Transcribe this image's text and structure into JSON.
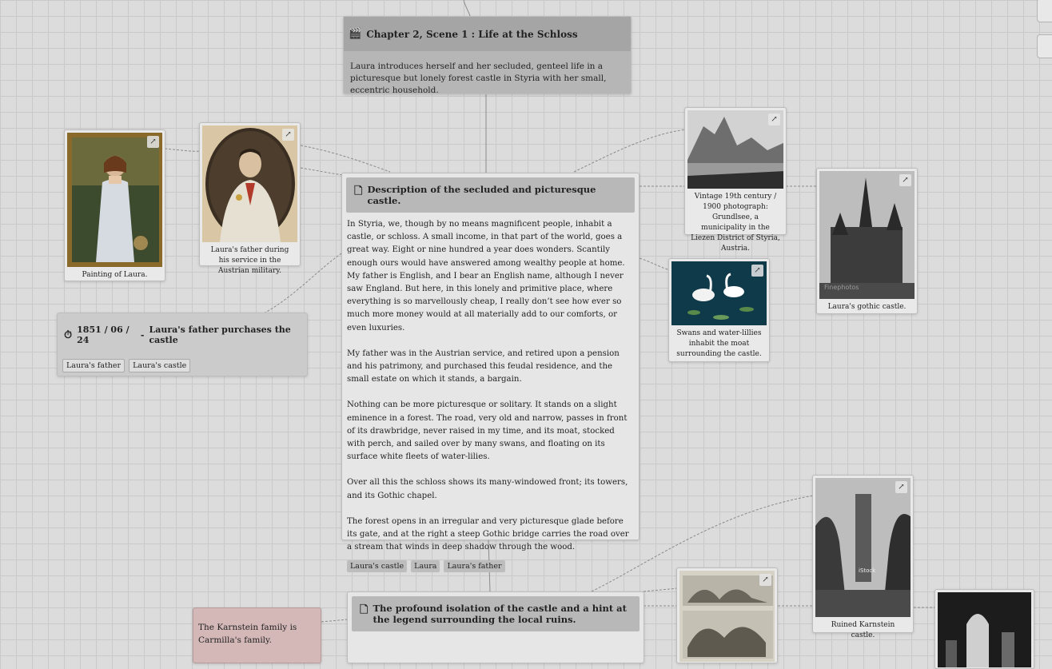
{
  "scene_card": {
    "icon": "clapperboard-icon",
    "title": "Chapter 2, Scene 1 : Life at the Schloss",
    "description": "Laura introduces herself and her secluded, genteel life in a picturesque but lonely forest castle in Styria with her small, eccentric household."
  },
  "description_card": {
    "icon": "document-icon",
    "title": "Description of the secluded and picturesque castle.",
    "paragraphs": [
      "In Styria, we, though by no means magnificent people, inhabit a castle, or schloss. A small income, in that part of the world, goes a great way. Eight or nine hundred a year does wonders. Scantily enough ours would have answered among wealthy people at home. My father is English, and I bear an English name, although I never saw England. But here, in this lonely and primitive place, where everything is so marvellously cheap, I really don’t see how ever so much more money would at all materially add to our comforts, or even luxuries.",
      "My father was in the Austrian service, and retired upon a pension and his patrimony, and purchased this feudal residence, and the small estate on which it stands, a bargain.",
      "Nothing can be more picturesque or solitary. It stands on a slight eminence in a forest. The road, very old and narrow, passes in front of its drawbridge, never raised in my time, and its moat, stocked with perch, and sailed over by many swans, and floating on its surface white fleets of water-lilies.",
      "Over all this the schloss shows its many-windowed front; its towers, and its Gothic chapel.",
      "The forest opens in an irregular and very picturesque glade before its gate, and at the right a steep Gothic bridge carries the road over a stream that winds in deep shadow through the wood."
    ],
    "tags": [
      "Laura's castle",
      "Laura",
      "Laura's father"
    ]
  },
  "event_card": {
    "icon": "stopwatch-icon",
    "date": "1851 / 06 / 24",
    "separator": "-",
    "title": "Laura's father purchases the castle",
    "tags": [
      "Laura's father",
      "Laura's castle"
    ]
  },
  "isolation_card": {
    "icon": "document-icon",
    "title": "The profound isolation of the castle and a hint at the legend surrounding the local ruins."
  },
  "karnstein_note": {
    "text": "The Karnstein family is Carmilla's family."
  },
  "images": {
    "laura_painting": {
      "caption": "Painting of Laura."
    },
    "father_portrait": {
      "caption": "Laura's father during his service in the Austrian military."
    },
    "grundlsee": {
      "caption": "Vintage 19th century / 1900 photograph: Grundlsee, a municipality in the Liezen District of Styria, Austria."
    },
    "gothic_castle": {
      "caption": "Laura's gothic castle.",
      "watermark": "Finephotos"
    },
    "swans": {
      "caption": "Swans and water-lillies inhabit the moat surrounding the castle."
    },
    "ruined_karnstein": {
      "caption": "Ruined Karnstein castle.",
      "watermark": "iStock"
    },
    "engraving": {
      "caption": ""
    },
    "graveyard": {
      "caption": ""
    }
  },
  "ext_icon_glyph": "↗",
  "corner_controls": [
    "",
    "",
    ""
  ]
}
